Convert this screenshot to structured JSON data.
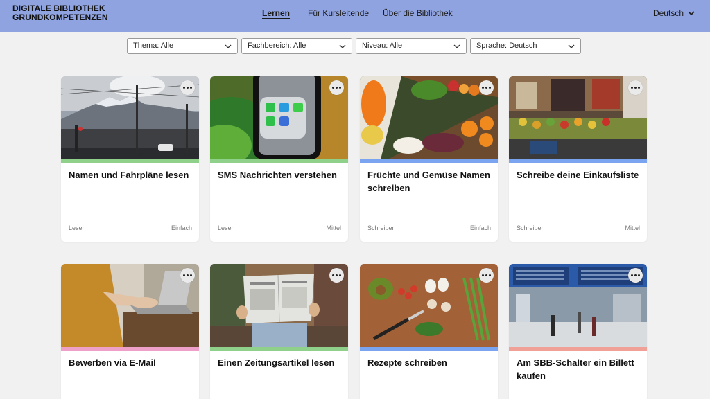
{
  "header": {
    "logo_line1": "DIGITALE BIBLIOTHEK",
    "logo_line2": "GRUNDKOMPETENZEN",
    "nav": [
      {
        "label": "Lernen",
        "active": true
      },
      {
        "label": "Für Kursleitende",
        "active": false
      },
      {
        "label": "Über die Bibliothek",
        "active": false
      }
    ],
    "language": "Deutsch"
  },
  "filters": [
    {
      "label": "Thema: Alle"
    },
    {
      "label": "Fachbereich: Alle"
    },
    {
      "label": "Niveau: Alle"
    },
    {
      "label": "Sprache: Deutsch"
    }
  ],
  "colors": {
    "header_bg": "#8fa3e0",
    "green": "#8fd08a",
    "blue": "#7aa3f0",
    "pink": "#efa0c8",
    "salmon": "#f0a096"
  },
  "cards": [
    {
      "title": "Namen und Fahrpläne lesen",
      "category": "Lesen",
      "level": "Einfach",
      "image_icon": "mountain-street-photo",
      "bar_color": "#8fd08a"
    },
    {
      "title": "SMS Nachrichten verstehen",
      "category": "Lesen",
      "level": "Mittel",
      "image_icon": "smartphone-photo",
      "bar_color": "#8fd08a"
    },
    {
      "title": "Früchte und Gemüse Namen schreiben",
      "category": "Schreiben",
      "level": "Einfach",
      "image_icon": "fruit-platter-photo",
      "bar_color": "#7aa3f0"
    },
    {
      "title": "Schreibe deine Einkaufsliste",
      "category": "Schreiben",
      "level": "Mittel",
      "image_icon": "market-stall-photo",
      "bar_color": "#7aa3f0"
    },
    {
      "title": "Bewerben via E-Mail",
      "category": "",
      "level": "",
      "image_icon": "laptop-typing-photo",
      "bar_color": "#efa0c8"
    },
    {
      "title": "Einen Zeitungsartikel lesen",
      "category": "",
      "level": "",
      "image_icon": "newspaper-photo",
      "bar_color": "#8fd08a"
    },
    {
      "title": "Rezepte schreiben",
      "category": "",
      "level": "",
      "image_icon": "cooking-ingredients-photo",
      "bar_color": "#7aa3f0"
    },
    {
      "title": "Am SBB-Schalter ein Billett kaufen",
      "category": "",
      "level": "",
      "image_icon": "train-station-photo",
      "bar_color": "#f0a096"
    }
  ]
}
